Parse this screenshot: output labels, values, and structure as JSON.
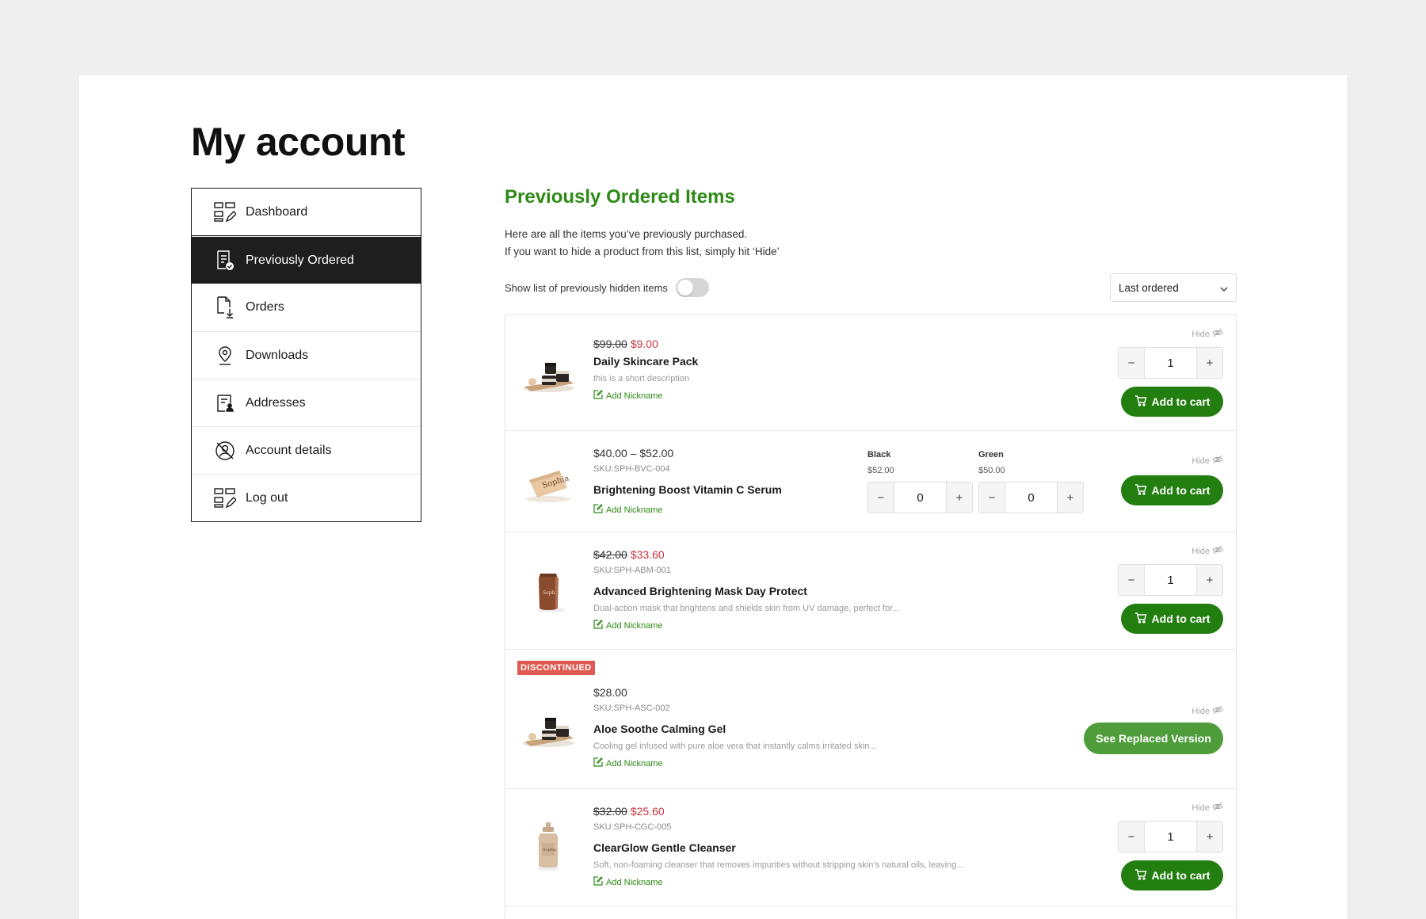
{
  "page": {
    "title": "My account"
  },
  "sidebar": {
    "items": [
      {
        "label": "Dashboard",
        "icon": "dashboard-icon"
      },
      {
        "label": "Previously Ordered",
        "icon": "receipt-check-icon",
        "active": true
      },
      {
        "label": "Orders",
        "icon": "file-download-icon"
      },
      {
        "label": "Downloads",
        "icon": "location-pin-icon"
      },
      {
        "label": "Addresses",
        "icon": "address-card-icon"
      },
      {
        "label": "Account details",
        "icon": "user-off-icon"
      },
      {
        "label": "Log out",
        "icon": "logout-grid-icon"
      }
    ]
  },
  "main": {
    "title": "Previously Ordered Items",
    "intro_line1": "Here are all the items you’ve previously purchased.",
    "intro_line2": "If you want to hide a product from this list, simply hit ‘Hide’",
    "toggle_label": "Show list of previously hidden items",
    "toggle_on": false,
    "sort_selected": "Last ordered",
    "hide_label": "Hide",
    "nickname_label": "Add Nickname",
    "add_to_cart_label": "Add to cart",
    "minus": "−",
    "plus": "+"
  },
  "products": [
    {
      "old_price": "$99.00",
      "new_price": "$9.00",
      "name": "Daily Skincare Pack",
      "desc": "this is a short description",
      "qty": "1"
    },
    {
      "price_range": "$40.00 – $52.00",
      "sku": "SKU:SPH-BVC-004",
      "name": "Brightening Boost Vitamin C Serum",
      "variants": [
        {
          "name": "Black",
          "price": "$52.00",
          "qty": "0"
        },
        {
          "name": "Green",
          "price": "$50.00",
          "qty": "0"
        }
      ]
    },
    {
      "old_price": "$42.00",
      "new_price": "$33.60",
      "sku": "SKU:SPH-ABM-001",
      "name": "Advanced Brightening Mask Day Protect",
      "desc": "Dual-action mask that brightens and shields skin from UV damage, perfect for...",
      "qty": "1"
    },
    {
      "badge": "DISCONTINUED",
      "price": "$28.00",
      "sku": "SKU:SPH-ASC-002",
      "name": "Aloe Soothe Calming Gel",
      "desc": "Cooling gel infused with pure aloe vera that instantly calms irritated skin...",
      "replace_label": "See Replaced Version"
    },
    {
      "old_price": "$32.00",
      "new_price": "$25.60",
      "sku": "SKU:SPH-CGC-005",
      "name": "ClearGlow Gentle Cleanser",
      "desc": "Soft, non-foaming cleanser that removes impurities without stripping skin’s natural oils, leaving...",
      "qty": "1"
    }
  ],
  "colors": {
    "accent_green": "#2e8a17",
    "button_green": "#237e10",
    "replace_green": "#4e9d3a",
    "sale_red": "#c8323a",
    "badge_red": "#e05a52",
    "active_nav": "#1e1e1e"
  }
}
